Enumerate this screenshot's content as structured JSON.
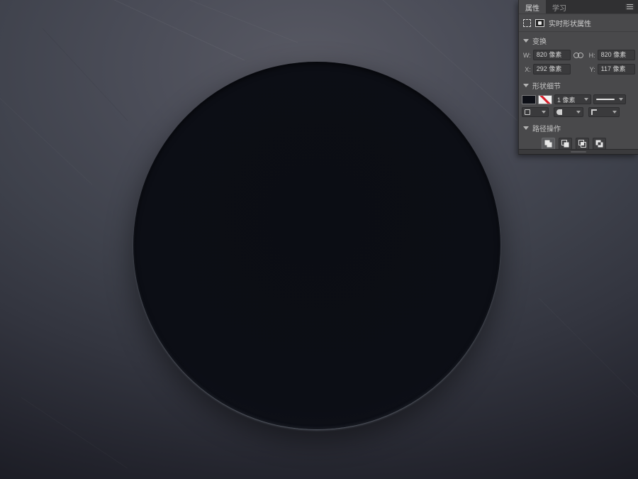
{
  "panel": {
    "tabs": [
      {
        "label": "属性"
      },
      {
        "label": "学习"
      }
    ],
    "title_row": {
      "title": "实时形状属性"
    },
    "sections": {
      "transform": {
        "label": "变换",
        "fields": {
          "w": {
            "label": "W:",
            "value": "820 像素"
          },
          "h": {
            "label": "H:",
            "value": "820 像素"
          },
          "x": {
            "label": "X:",
            "value": "292 像素"
          },
          "y": {
            "label": "Y:",
            "value": "117 像素"
          }
        }
      },
      "shape_details": {
        "label": "形状细节",
        "fill_color": "#0d0f16",
        "stroke_color": "none",
        "stroke_width": "1 像素"
      },
      "path_operations": {
        "label": "路径操作",
        "buttons": [
          {
            "name": "combine-shapes",
            "selected": true
          },
          {
            "name": "subtract-front-shape",
            "selected": false
          },
          {
            "name": "intersect-shape-areas",
            "selected": false
          },
          {
            "name": "exclude-overlapping-shapes",
            "selected": false
          }
        ]
      }
    }
  },
  "canvas": {
    "background_base": "#3e414b",
    "background_highlight": "#585963",
    "background_vignette": "#15161d",
    "circle_color": "#0b0d14"
  }
}
